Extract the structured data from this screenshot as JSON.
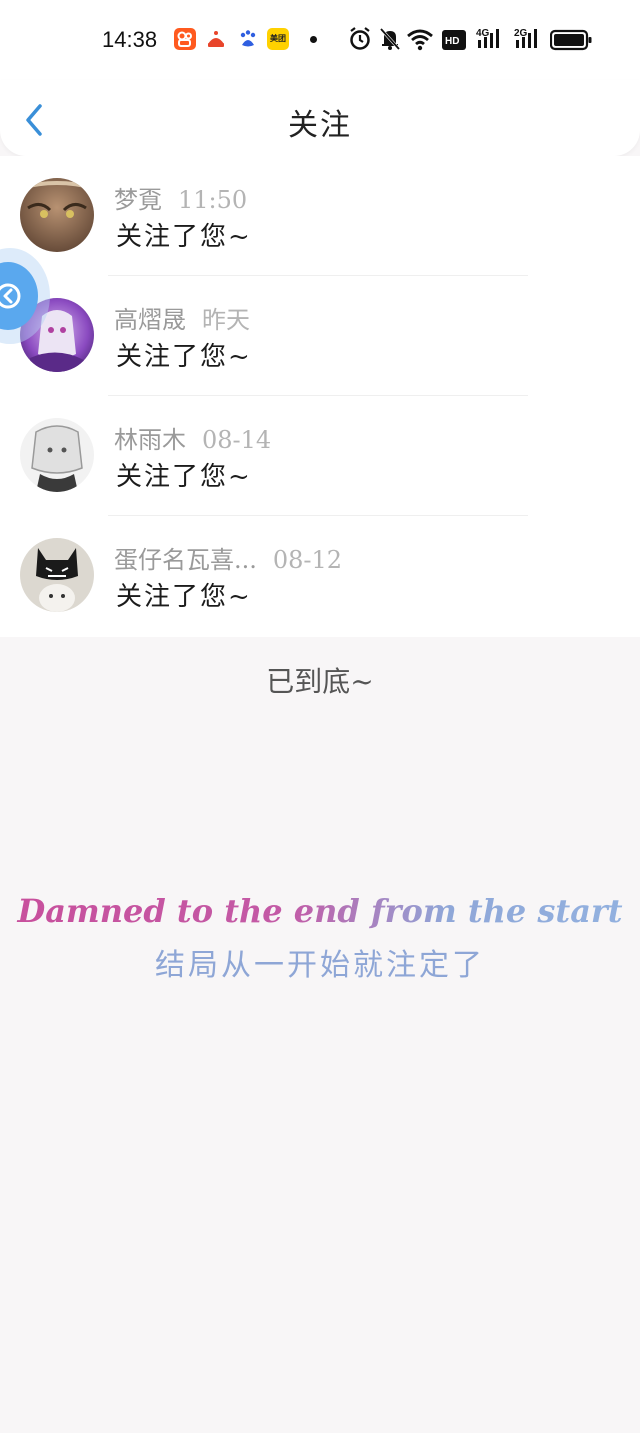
{
  "status_bar": {
    "time": "14:38",
    "meituan_label": "美团",
    "icons": [
      "kuaishou-icon",
      "toutiao-icon",
      "baidu-icon",
      "meituan-icon",
      "alarm-icon",
      "mute-icon",
      "wifi-icon",
      "hd-icon",
      "signal-4g-icon",
      "signal-2g-icon",
      "battery-icon"
    ],
    "hd_label": "HD",
    "net1_label": "4G",
    "net2_label": "2G"
  },
  "header": {
    "title": "关注"
  },
  "notifications": [
    {
      "name": "梦覔",
      "time": "11:50",
      "message": "关注了您~",
      "avatar_color": "#8a6a4a"
    },
    {
      "name": "高熠晟",
      "time": "昨天",
      "message": "关注了您~",
      "avatar_color": "#7a4aa8"
    },
    {
      "name": "林雨木",
      "time": "08-14",
      "message": "关注了您~",
      "avatar_color": "#cfcfcf"
    },
    {
      "name": "蛋仔名瓦喜...",
      "time": "08-12",
      "message": "关注了您~",
      "avatar_color": "#d8d4cc"
    }
  ],
  "end_text": "已到底~",
  "quote": {
    "en": "Damned to the end from the start",
    "zh": "结局从一开始就注定了"
  },
  "colors": {
    "accent": "#3a8fd8",
    "background": "#f8f6f7"
  }
}
